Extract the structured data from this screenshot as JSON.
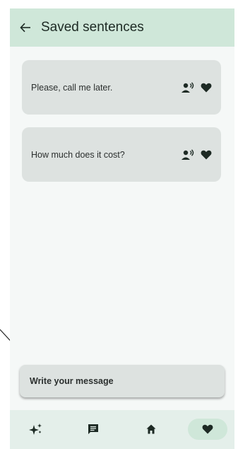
{
  "header": {
    "title": "Saved sentences",
    "back_icon": "arrow-left-icon"
  },
  "sentences": [
    {
      "text": "Please, call me later.",
      "speak_icon": "speaker-icon",
      "favorite_icon": "heart-icon"
    },
    {
      "text": "How much does it cost?",
      "speak_icon": "speaker-icon",
      "favorite_icon": "heart-icon"
    }
  ],
  "message_input": {
    "placeholder": "Write your message"
  },
  "bottom_nav": {
    "items": [
      {
        "icon": "sparkle-icon",
        "active": false
      },
      {
        "icon": "chat-icon",
        "active": false
      },
      {
        "icon": "home-icon",
        "active": false
      },
      {
        "icon": "heart-icon",
        "active": true
      }
    ]
  },
  "colors": {
    "header_bg": "#cfe7d9",
    "screen_bg": "#f5f8f7",
    "card_bg": "#dde2e0",
    "nav_bg": "#e4efea",
    "active_pill": "#cfe7d9",
    "icon_dark": "#1d2a24"
  }
}
